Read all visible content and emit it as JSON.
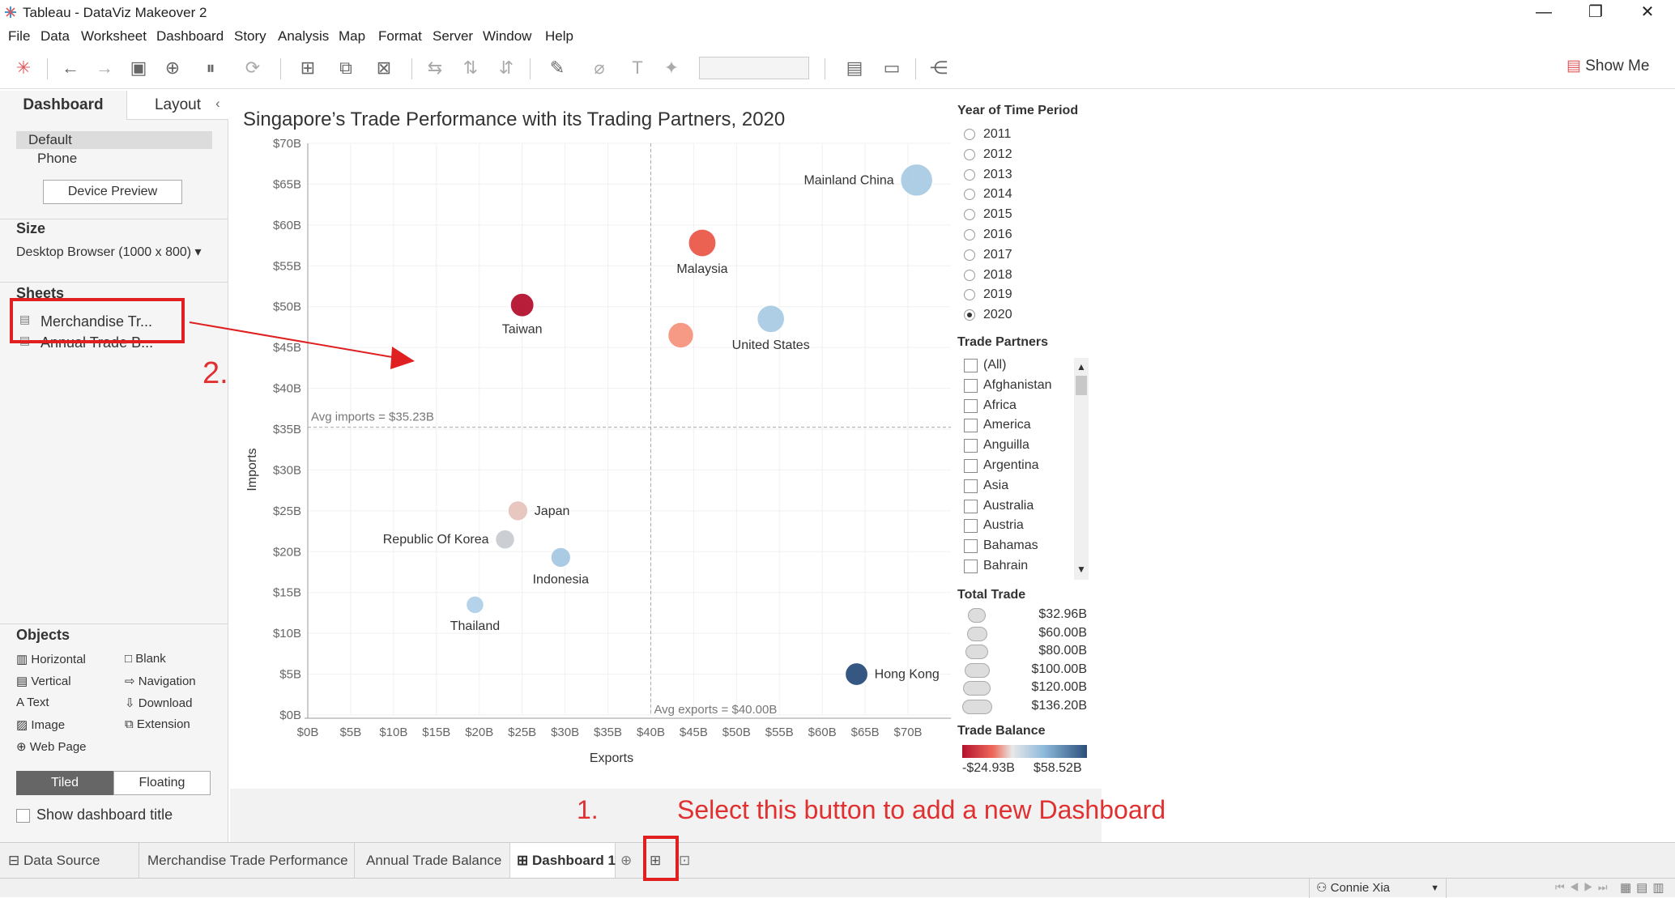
{
  "window": {
    "title": "Tableau - DataViz Makeover 2",
    "controls": [
      "—",
      "❐",
      "✕"
    ]
  },
  "menu": [
    "File",
    "Data",
    "Worksheet",
    "Dashboard",
    "Story",
    "Analysis",
    "Map",
    "Format",
    "Server",
    "Window",
    "Help"
  ],
  "toolbar": {
    "show_me": "Show Me"
  },
  "left_pane": {
    "tabs": [
      "Dashboard",
      "Layout"
    ],
    "device_items": [
      "Default",
      "Phone"
    ],
    "device_preview": "Device Preview",
    "size_header": "Size",
    "size_value": "Desktop Browser (1000 x 800)",
    "sheets_header": "Sheets",
    "sheets": [
      "Merchandise Tr...",
      "Annual Trade B..."
    ],
    "objects_header": "Objects",
    "objects": [
      "Horizontal",
      "Blank",
      "Vertical",
      "Navigation",
      "Text",
      "Download",
      "Image",
      "Extension",
      "Web Page"
    ],
    "tiled": "Tiled",
    "floating": "Floating",
    "show_title": "Show dashboard title"
  },
  "chart_data": {
    "type": "scatter",
    "title": "Singapore’s Trade Performance with its Trading Partners, 2020",
    "xlabel": "Exports",
    "ylabel": "Imports",
    "xlim": [
      0,
      75
    ],
    "ylim": [
      0,
      70
    ],
    "x_ticks": [
      "$0B",
      "$5B",
      "$10B",
      "$15B",
      "$20B",
      "$25B",
      "$30B",
      "$35B",
      "$40B",
      "$45B",
      "$50B",
      "$55B",
      "$60B",
      "$65B",
      "$70B"
    ],
    "y_ticks": [
      "$0B",
      "$5B",
      "$10B",
      "$15B",
      "$20B",
      "$25B",
      "$30B",
      "$35B",
      "$40B",
      "$45B",
      "$50B",
      "$55B",
      "$60B",
      "$65B",
      "$70B"
    ],
    "ref_lines": {
      "avg_imports": 35.23,
      "avg_exports": 40.0,
      "avg_imports_label": "Avg imports = $35.23B",
      "avg_exports_label": "Avg exports = $40.00B"
    },
    "points": [
      {
        "label": "Mainland China",
        "x": 71,
        "y": 65.5,
        "total": 136.2,
        "color": "#a9cce4"
      },
      {
        "label": "Malaysia",
        "x": 46,
        "y": 57.8,
        "total": 103.8,
        "color": "#ea5a4a"
      },
      {
        "label": "Taiwan",
        "x": 25,
        "y": 50.2,
        "total": 75.2,
        "color": "#b5112f"
      },
      {
        "label": "",
        "x": 43.5,
        "y": 46.5,
        "total": 90,
        "color": "#f7957f"
      },
      {
        "label": "United States",
        "x": 54,
        "y": 48.5,
        "total": 102.5,
        "color": "#a9cce4"
      },
      {
        "label": "Japan",
        "x": 24.5,
        "y": 25,
        "total": 49.5,
        "color": "#e6c5bd"
      },
      {
        "label": "Republic Of Korea",
        "x": 23,
        "y": 21.5,
        "total": 44.5,
        "color": "#c9ccd0"
      },
      {
        "label": "Indonesia",
        "x": 29.5,
        "y": 19.3,
        "total": 48.8,
        "color": "#a7c8e2"
      },
      {
        "label": "Thailand",
        "x": 19.5,
        "y": 13.5,
        "total": 33,
        "color": "#b0d0e8"
      },
      {
        "label": "Hong Kong",
        "x": 64,
        "y": 5,
        "total": 69,
        "color": "#2b4f7c"
      }
    ]
  },
  "filters": {
    "year_header": "Year of Time Period",
    "years": [
      "2011",
      "2012",
      "2013",
      "2014",
      "2015",
      "2016",
      "2017",
      "2018",
      "2019",
      "2020"
    ],
    "selected_year": "2020",
    "partners_header": "Trade Partners",
    "partners": [
      "(All)",
      "Afghanistan",
      "Africa",
      "America",
      "Anguilla",
      "Argentina",
      "Asia",
      "Australia",
      "Austria",
      "Bahamas",
      "Bahrain"
    ],
    "total_trade_header": "Total Trade",
    "total_trade": [
      "$32.96B",
      "$60.00B",
      "$80.00B",
      "$100.00B",
      "$120.00B",
      "$136.20B"
    ],
    "balance_header": "Trade Balance",
    "balance_min": "-$24.93B",
    "balance_max": "$58.52B"
  },
  "bottom_tabs": [
    "Data Source",
    "Merchandise Trade Performance",
    "Annual Trade Balance",
    "Dashboard 1"
  ],
  "status": {
    "user": "Connie Xia"
  },
  "annotations": {
    "step1_num": "1.",
    "step1_text": "Select this button to add a new Dashboard",
    "step2_num": "2."
  }
}
